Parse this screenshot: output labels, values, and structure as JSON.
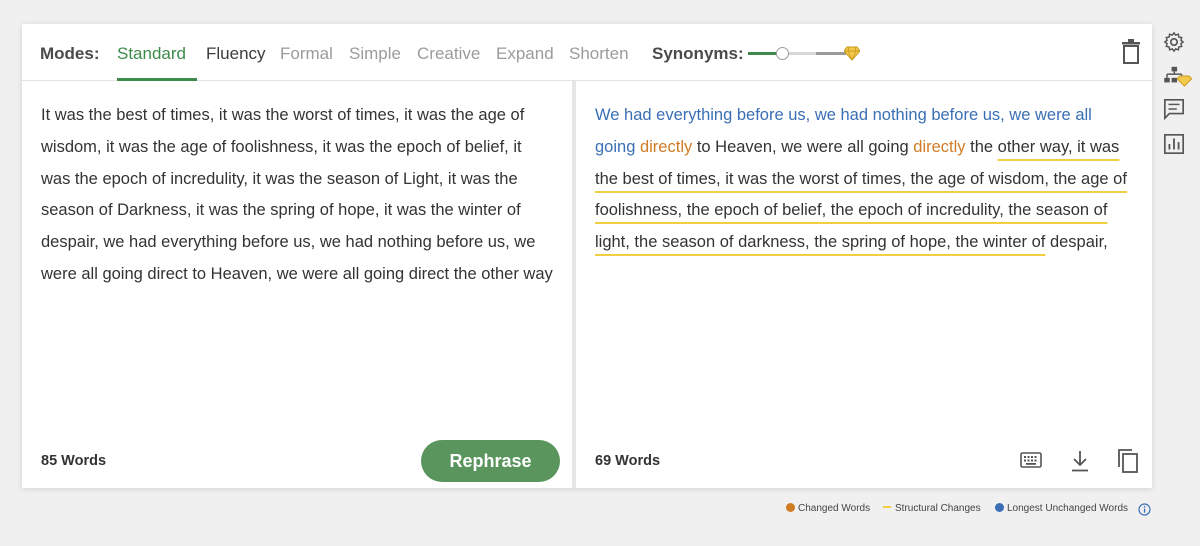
{
  "modes_bar": {
    "label": "Modes:",
    "modes": [
      "Standard",
      "Fluency",
      "Formal",
      "Simple",
      "Creative",
      "Expand",
      "Shorten"
    ],
    "active_mode": "Standard",
    "synonyms_label": "Synonyms:",
    "synonyms_level": 0.33
  },
  "input": {
    "text": "It was the best of times, it was the worst of times, it was the age of wisdom, it was the age of foolishness, it was the epoch of belief, it was the epoch of incredulity, it was the season of Light, it was the season of Darkness, it was the spring of hope, it was the winter of despair, we had everything before us, we had nothing before us, we were all going direct to Heaven, we were all going direct the other way",
    "word_count": "85 Words",
    "rephrase_label": "Rephrase"
  },
  "output": {
    "segments": [
      {
        "text": "We had everything before us, we had nothing before us, we were all going",
        "type": "longest"
      },
      {
        "text": " ",
        "type": "normal"
      },
      {
        "text": "directly",
        "type": "changed"
      },
      {
        "text": " to Heaven, we were all going ",
        "type": "normal"
      },
      {
        "text": "directly",
        "type": "changed"
      },
      {
        "text": " the ",
        "type": "normal"
      },
      {
        "text": "other way, it was the best of times, it was the worst of times, the age of wisdom, the age of foolishness, the epoch of belief, the epoch of incredulity, the season of light, the season of darkness, the spring of hope, the winter of",
        "type": "structural"
      },
      {
        "text": " despair,",
        "type": "normal"
      }
    ],
    "word_count": "69 Words"
  },
  "legend": {
    "changed": "Changed Words",
    "structural": "Structural Changes",
    "longest": "Longest Unchanged Words"
  },
  "colors": {
    "accent_green": "#3d8a4a",
    "rephrase_button": "#5a955e",
    "changed": "#d27b25",
    "structural": "#f0d040",
    "longest": "#3a6fb5"
  },
  "icons": {
    "toolbar": [
      "trash-icon"
    ],
    "output_tools": [
      "keyboard-icon",
      "download-icon",
      "copy-icon"
    ],
    "sidebar": [
      "gear-icon",
      "hierarchy-premium-icon",
      "comment-icon",
      "bar-chart-icon"
    ],
    "legend_info": "info-icon"
  }
}
